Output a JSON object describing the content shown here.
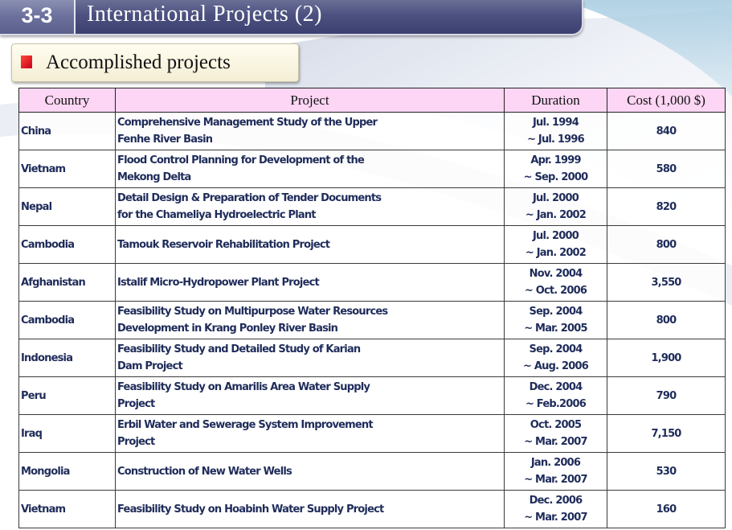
{
  "header": {
    "number": "3-3",
    "title": "International Projects (2)"
  },
  "subtitle": "Accomplished projects",
  "colors": {
    "header_bg": "#4c5180",
    "table_header_bg": "#fcd6f4",
    "cell_text": "#1f2c5a",
    "marker": "#e0001e"
  },
  "table": {
    "columns": [
      "Country",
      "Project",
      "Duration",
      "Cost (1,000 $)"
    ],
    "rows": [
      {
        "country": "China",
        "project": [
          "Comprehensive Management Study of the Upper",
          "Fenhe River Basin"
        ],
        "duration": [
          "Jul. 1994",
          "~ Jul. 1996"
        ],
        "cost": "840"
      },
      {
        "country": "Vietnam",
        "project": [
          "Flood Control Planning for Development of the",
          "Mekong Delta"
        ],
        "duration": [
          "Apr. 1999",
          "~ Sep. 2000"
        ],
        "cost": "580"
      },
      {
        "country": "Nepal",
        "project": [
          "Detail Design & Preparation of Tender Documents",
          "for the Chameliya Hydroelectric Plant"
        ],
        "duration": [
          "Jul. 2000",
          "~ Jan. 2002"
        ],
        "cost": "820"
      },
      {
        "country": "Cambodia",
        "project": [
          "Tamouk Reservoir Rehabilitation Project"
        ],
        "duration": [
          "Jul. 2000",
          "~ Jan. 2002"
        ],
        "cost": "800"
      },
      {
        "country": "Afghanistan",
        "project": [
          "Istalif Micro-Hydropower Plant Project"
        ],
        "duration": [
          "Nov. 2004",
          "~ Oct. 2006"
        ],
        "cost": "3,550"
      },
      {
        "country": "Cambodia",
        "project": [
          "Feasibility Study on Multipurpose Water Resources",
          "Development in Krang Ponley River Basin"
        ],
        "duration": [
          "Sep. 2004",
          "~ Mar. 2005"
        ],
        "cost": "800"
      },
      {
        "country": "Indonesia",
        "project": [
          "Feasibility Study and Detailed Study of Karian",
          "Dam Project"
        ],
        "duration": [
          "Sep. 2004",
          "~ Aug. 2006"
        ],
        "cost": "1,900"
      },
      {
        "country": "Peru",
        "project": [
          "Feasibility Study on Amarilis Area Water Supply",
          "Project"
        ],
        "duration": [
          "Dec. 2004",
          "~ Feb.2006"
        ],
        "cost": "790"
      },
      {
        "country": "Iraq",
        "project": [
          "Erbil Water and Sewerage System Improvement",
          "Project"
        ],
        "duration": [
          "Oct. 2005",
          "~ Mar. 2007"
        ],
        "cost": "7,150"
      },
      {
        "country": "Mongolia",
        "project": [
          "Construction of New Water Wells"
        ],
        "duration": [
          "Jan. 2006",
          "~ Mar. 2007"
        ],
        "cost": "530"
      },
      {
        "country": "Vietnam",
        "project": [
          "Feasibility Study on Hoabinh Water Supply Project"
        ],
        "duration": [
          "Dec. 2006",
          "~ Mar. 2007"
        ],
        "cost": "160"
      }
    ]
  }
}
